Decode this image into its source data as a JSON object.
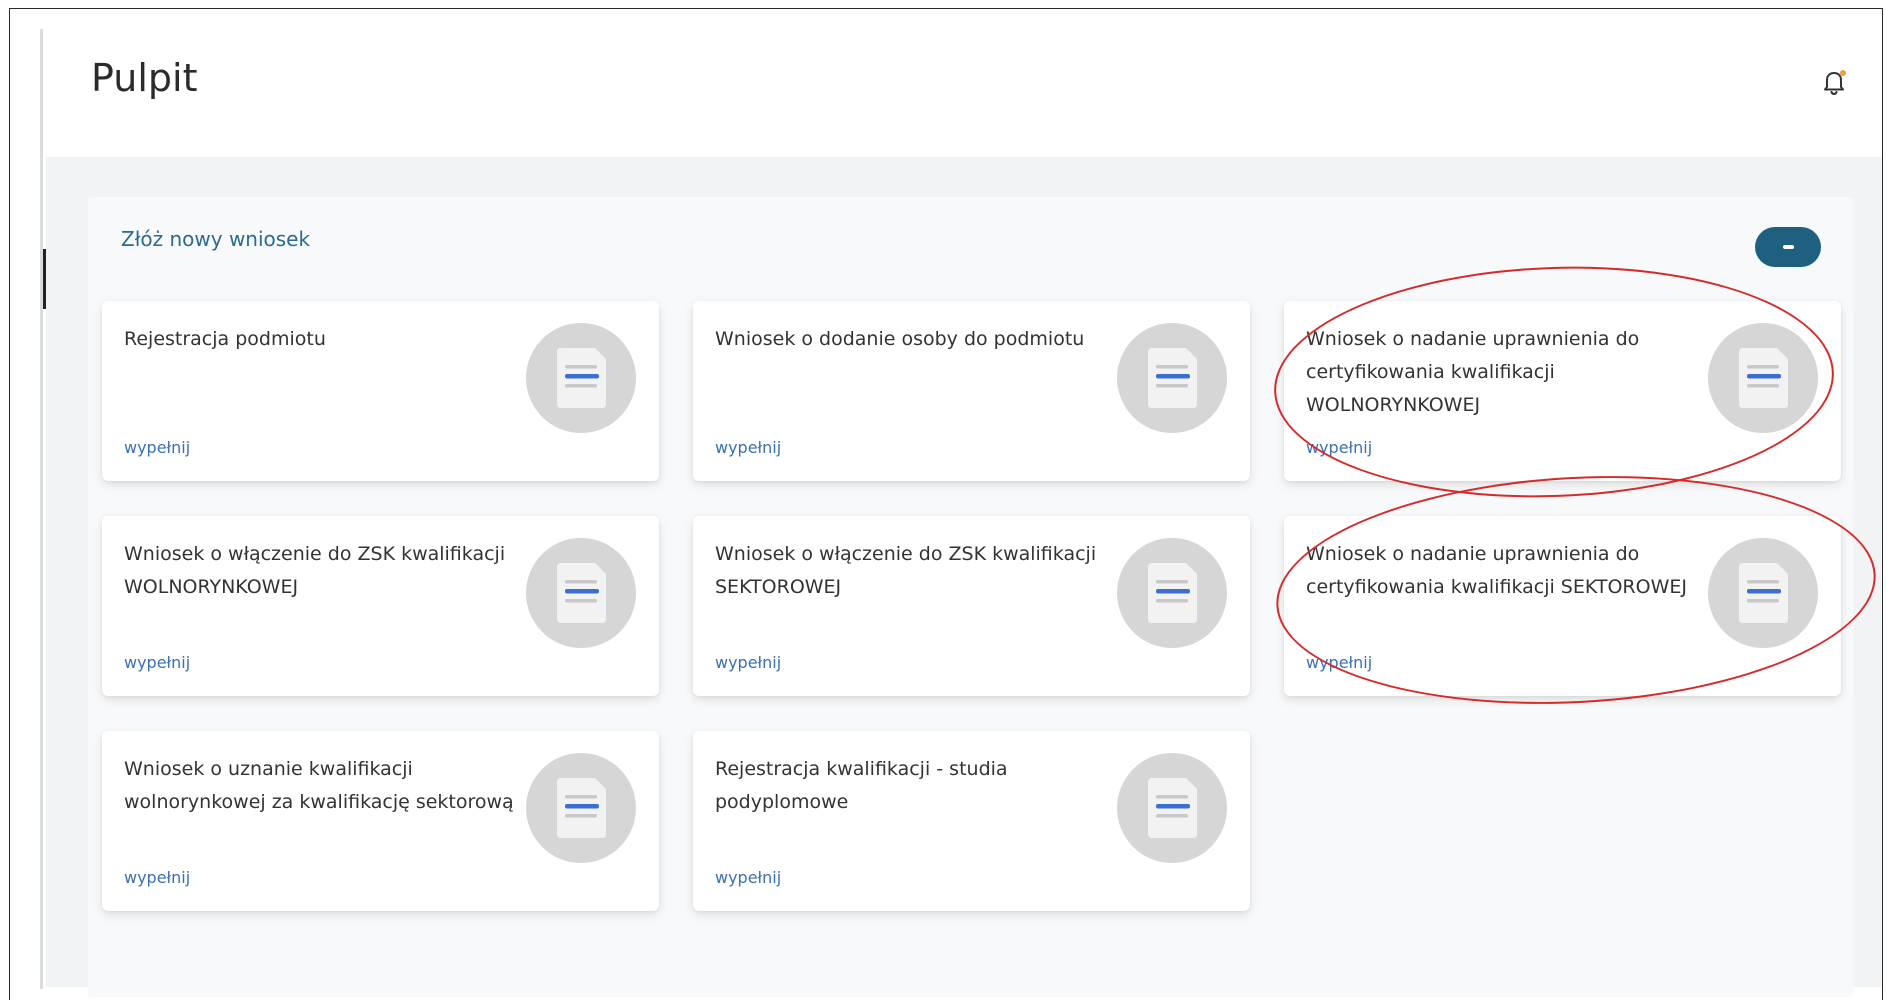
{
  "header": {
    "title": "Pulpit"
  },
  "panel": {
    "title": "Złóż nowy wniosek",
    "collapse_label": "−"
  },
  "cards": [
    {
      "title": "Rejestracja podmiotu",
      "link": "wypełnij"
    },
    {
      "title": "Wniosek o dodanie osoby do podmiotu",
      "link": "wypełnij"
    },
    {
      "title": "Wniosek o nadanie uprawnienia do certyfikowania kwalifikacji WOLNORYNKOWEJ",
      "link": "wypełnij"
    },
    {
      "title": "Wniosek o włączenie do ZSK kwalifikacji WOLNORYNKOWEJ",
      "link": "wypełnij"
    },
    {
      "title": "Wniosek o włączenie do ZSK kwalifikacji SEKTOROWEJ",
      "link": "wypełnij"
    },
    {
      "title": "Wniosek o nadanie uprawnienia do certyfikowania kwalifikacji SEKTOROWEJ",
      "link": "wypełnij"
    },
    {
      "title": "Wniosek o uznanie kwalifikacji wolnorynkowej za kwalifikację sektorową",
      "link": "wypełnij"
    },
    {
      "title": "Rejestracja kwalifikacji - studia podyplomowe",
      "link": "wypełnij"
    }
  ],
  "icons": {
    "notification": "bell-icon",
    "document": "document-icon"
  },
  "colors": {
    "accent": "#1f5f80",
    "link": "#3b6fb6",
    "highlight": "#d62a2a",
    "notification_dot": "#e8a33d"
  }
}
